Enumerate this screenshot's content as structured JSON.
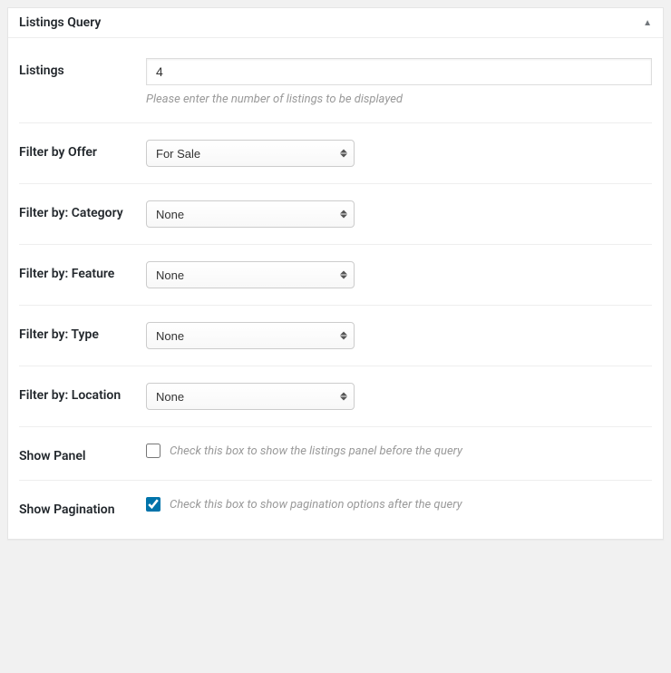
{
  "panel": {
    "title": "Listings Query"
  },
  "fields": {
    "listings": {
      "label": "Listings",
      "value": "4",
      "help": "Please enter the number of listings to be displayed"
    },
    "offer": {
      "label": "Filter by Offer",
      "value": "For Sale"
    },
    "category": {
      "label": "Filter by: Category",
      "value": "None"
    },
    "feature": {
      "label": "Filter by: Feature",
      "value": "None"
    },
    "type": {
      "label": "Filter by: Type",
      "value": "None"
    },
    "location": {
      "label": "Filter by: Location",
      "value": "None"
    },
    "show_panel": {
      "label": "Show Panel",
      "help": "Check this box to show the listings panel before the query",
      "checked": false
    },
    "show_pagination": {
      "label": "Show Pagination",
      "help": "Check this box to show pagination options after the query",
      "checked": true
    }
  }
}
